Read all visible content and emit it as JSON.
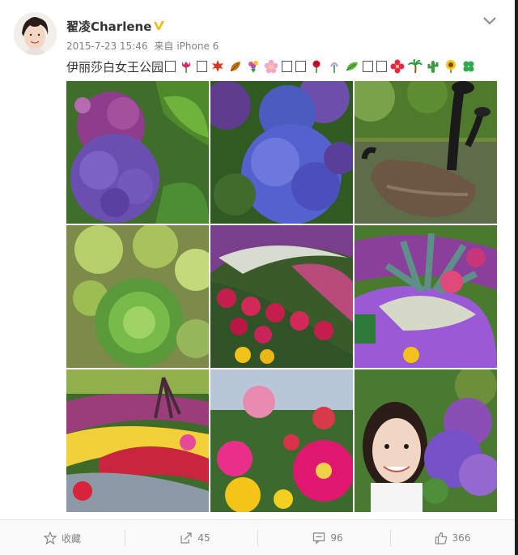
{
  "user": {
    "name": "翟凌Charlene"
  },
  "post": {
    "timestamp": "2015-7-23 15:46",
    "source_prefix": "来自",
    "device": "iPhone 6",
    "text": "伊丽莎白女王公园"
  },
  "photos": [
    {
      "id": "hydrangea-purple"
    },
    {
      "id": "hydrangea-blue"
    },
    {
      "id": "canada-geese"
    },
    {
      "id": "succulents"
    },
    {
      "id": "flower-bed-red"
    },
    {
      "id": "agave-garden"
    },
    {
      "id": "garden-bed-colorful"
    },
    {
      "id": "zinnias"
    },
    {
      "id": "selfie-hydrangea"
    }
  ],
  "actions": {
    "favorite": "收藏",
    "repost": "45",
    "comment": "96",
    "like": "366"
  },
  "colors": {
    "verified": "#f5b800",
    "meta": "#808080",
    "text": "#333333"
  }
}
